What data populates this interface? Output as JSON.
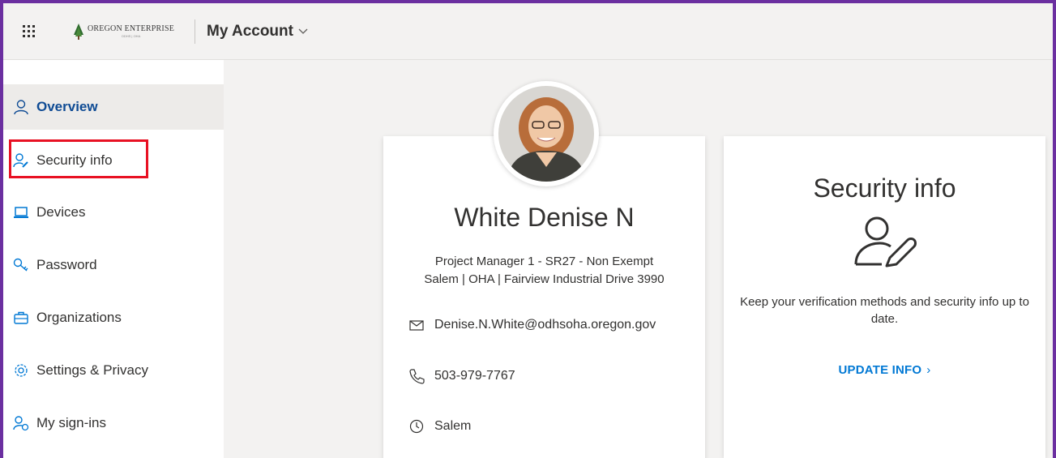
{
  "header": {
    "logo_main": "OREGON ENTERPRISE",
    "logo_sub": "ODHS | OHA",
    "app_title": "My Account"
  },
  "sidebar": {
    "items": [
      {
        "label": "Overview",
        "icon": "person-icon",
        "active": true
      },
      {
        "label": "Security info",
        "icon": "person-key-icon",
        "active": false
      },
      {
        "label": "Devices",
        "icon": "laptop-icon",
        "active": false
      },
      {
        "label": "Password",
        "icon": "key-icon",
        "active": false
      },
      {
        "label": "Organizations",
        "icon": "briefcase-icon",
        "active": false
      },
      {
        "label": "Settings & Privacy",
        "icon": "gear-icon",
        "active": false
      },
      {
        "label": "My sign-ins",
        "icon": "person-sync-icon",
        "active": false
      }
    ]
  },
  "profile": {
    "name": "White Denise N",
    "title": "Project Manager 1 - SR27 - Non Exempt",
    "location": "Salem | OHA | Fairview Industrial Drive 3990",
    "email": "Denise.N.White@odhsoha.oregon.gov",
    "phone": "503-979-7767",
    "office": "Salem"
  },
  "security_card": {
    "title": "Security info",
    "description": "Keep your verification methods and security info up to date.",
    "link": "UPDATE INFO",
    "link_arrow": "›"
  },
  "colors": {
    "frame": "#6b2fa0",
    "accent": "#0078d4",
    "active_nav_text": "#0f4b94",
    "highlight": "#e81123"
  }
}
